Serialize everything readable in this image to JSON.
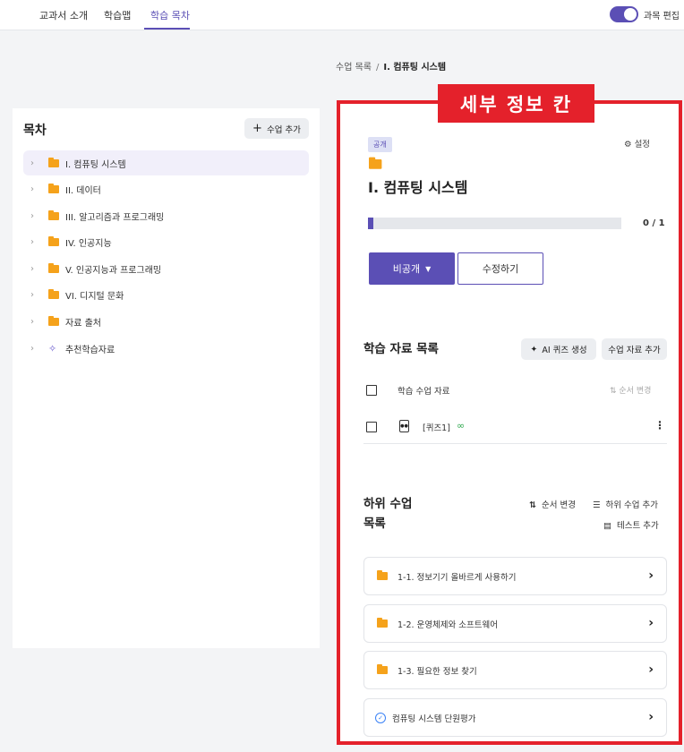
{
  "topnav": {
    "tabs": [
      {
        "label": "교과서 소개"
      },
      {
        "label": "학습맵"
      },
      {
        "label": "학습 목차"
      }
    ],
    "toggle_label": "과목 편집",
    "toggle_on": true
  },
  "breadcrumb": {
    "parent": "수업 목록",
    "separator": "/",
    "current": "I. 컴퓨팅 시스템"
  },
  "toc": {
    "title": "목차",
    "add_label": "수업 추가",
    "items": [
      {
        "label": "I. 컴퓨팅 시스템",
        "icon": "folder-icon",
        "selected": true
      },
      {
        "label": "II. 데이터",
        "icon": "folder-icon"
      },
      {
        "label": "III. 알고리즘과 프로그래밍",
        "icon": "folder-icon"
      },
      {
        "label": "IV. 인공지능",
        "icon": "folder-icon"
      },
      {
        "label": "V. 인공지능과 프로그래밍",
        "icon": "folder-icon"
      },
      {
        "label": "VI. 디지털 문화",
        "icon": "folder-icon"
      },
      {
        "label": "자료 출처",
        "icon": "folder-icon"
      },
      {
        "label": "추천학습자료",
        "icon": "magic-wand-icon"
      }
    ]
  },
  "detail": {
    "annotation": "세부 정보 칸",
    "badge": "공개",
    "settings_label": "설정",
    "title": "I. 컴퓨팅 시스템",
    "progress": {
      "done": 0,
      "total": 1,
      "text": "0 / 1",
      "fill_fraction": 0.02
    },
    "private_btn": "비공개",
    "edit_btn": "수정하기",
    "materials": {
      "title": "학습 자료 목록",
      "ai_btn": "AI 퀴즈 생성",
      "add_btn": "수업 자료 추가",
      "column_header": "학습 수업 자료",
      "sort_label": "순서 변경",
      "rows": [
        {
          "label": "[퀴즈1]"
        }
      ]
    },
    "sublessons": {
      "title_line1": "하위 수업",
      "title_line2": "목록",
      "sort_label": "순서 변경",
      "add_label": "하위 수업 추가",
      "test_label": "테스트 추가",
      "items": [
        {
          "label": "1-1. 정보기기 올바르게 사용하기",
          "icon": "folder-icon"
        },
        {
          "label": "1-2. 운영체제와 소프트웨어",
          "icon": "folder-icon"
        },
        {
          "label": "1-3. 필요한 정보 찾기",
          "icon": "folder-icon"
        },
        {
          "label": "컴퓨팅 시스템 단원평가",
          "icon": "check-circle-icon"
        }
      ]
    }
  },
  "colors": {
    "accent": "#5b4fb5",
    "annotation": "#e4212b",
    "folder": "#f5a21b"
  }
}
